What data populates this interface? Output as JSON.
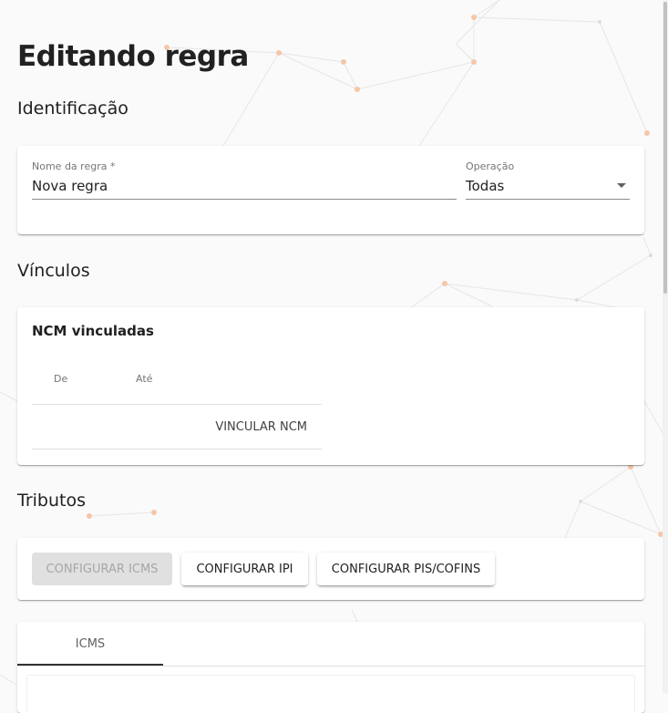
{
  "page": {
    "title": "Editando regra"
  },
  "sections": {
    "identification": "Identificação",
    "links": "Vínculos",
    "taxes": "Tributos"
  },
  "identification": {
    "name": {
      "label": "Nome da regra *",
      "value": "Nova regra"
    },
    "operation": {
      "label": "Operação",
      "value": "Todas"
    }
  },
  "ncm": {
    "title": "NCM vinculadas",
    "columns": [
      "De",
      "Até"
    ],
    "link_button": "VINCULAR NCM"
  },
  "taxes_buttons": {
    "icms": "CONFIGURAR ICMS",
    "ipi": "CONFIGURAR IPI",
    "pis_cofins": "CONFIGURAR PIS/COFINS"
  },
  "tabs": [
    {
      "label": "ICMS"
    }
  ]
}
